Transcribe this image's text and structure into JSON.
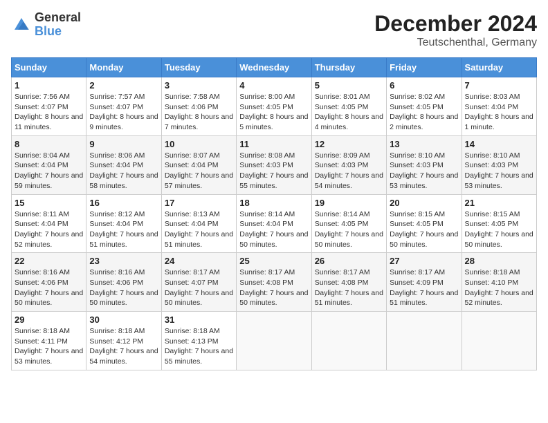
{
  "header": {
    "logo_general": "General",
    "logo_blue": "Blue",
    "title": "December 2024",
    "subtitle": "Teutschenthal, Germany"
  },
  "calendar": {
    "headers": [
      "Sunday",
      "Monday",
      "Tuesday",
      "Wednesday",
      "Thursday",
      "Friday",
      "Saturday"
    ],
    "weeks": [
      [
        {
          "day": "1",
          "sunrise": "Sunrise: 7:56 AM",
          "sunset": "Sunset: 4:07 PM",
          "daylight": "Daylight: 8 hours and 11 minutes."
        },
        {
          "day": "2",
          "sunrise": "Sunrise: 7:57 AM",
          "sunset": "Sunset: 4:07 PM",
          "daylight": "Daylight: 8 hours and 9 minutes."
        },
        {
          "day": "3",
          "sunrise": "Sunrise: 7:58 AM",
          "sunset": "Sunset: 4:06 PM",
          "daylight": "Daylight: 8 hours and 7 minutes."
        },
        {
          "day": "4",
          "sunrise": "Sunrise: 8:00 AM",
          "sunset": "Sunset: 4:05 PM",
          "daylight": "Daylight: 8 hours and 5 minutes."
        },
        {
          "day": "5",
          "sunrise": "Sunrise: 8:01 AM",
          "sunset": "Sunset: 4:05 PM",
          "daylight": "Daylight: 8 hours and 4 minutes."
        },
        {
          "day": "6",
          "sunrise": "Sunrise: 8:02 AM",
          "sunset": "Sunset: 4:05 PM",
          "daylight": "Daylight: 8 hours and 2 minutes."
        },
        {
          "day": "7",
          "sunrise": "Sunrise: 8:03 AM",
          "sunset": "Sunset: 4:04 PM",
          "daylight": "Daylight: 8 hours and 1 minute."
        }
      ],
      [
        {
          "day": "8",
          "sunrise": "Sunrise: 8:04 AM",
          "sunset": "Sunset: 4:04 PM",
          "daylight": "Daylight: 7 hours and 59 minutes."
        },
        {
          "day": "9",
          "sunrise": "Sunrise: 8:06 AM",
          "sunset": "Sunset: 4:04 PM",
          "daylight": "Daylight: 7 hours and 58 minutes."
        },
        {
          "day": "10",
          "sunrise": "Sunrise: 8:07 AM",
          "sunset": "Sunset: 4:04 PM",
          "daylight": "Daylight: 7 hours and 57 minutes."
        },
        {
          "day": "11",
          "sunrise": "Sunrise: 8:08 AM",
          "sunset": "Sunset: 4:03 PM",
          "daylight": "Daylight: 7 hours and 55 minutes."
        },
        {
          "day": "12",
          "sunrise": "Sunrise: 8:09 AM",
          "sunset": "Sunset: 4:03 PM",
          "daylight": "Daylight: 7 hours and 54 minutes."
        },
        {
          "day": "13",
          "sunrise": "Sunrise: 8:10 AM",
          "sunset": "Sunset: 4:03 PM",
          "daylight": "Daylight: 7 hours and 53 minutes."
        },
        {
          "day": "14",
          "sunrise": "Sunrise: 8:10 AM",
          "sunset": "Sunset: 4:03 PM",
          "daylight": "Daylight: 7 hours and 53 minutes."
        }
      ],
      [
        {
          "day": "15",
          "sunrise": "Sunrise: 8:11 AM",
          "sunset": "Sunset: 4:04 PM",
          "daylight": "Daylight: 7 hours and 52 minutes."
        },
        {
          "day": "16",
          "sunrise": "Sunrise: 8:12 AM",
          "sunset": "Sunset: 4:04 PM",
          "daylight": "Daylight: 7 hours and 51 minutes."
        },
        {
          "day": "17",
          "sunrise": "Sunrise: 8:13 AM",
          "sunset": "Sunset: 4:04 PM",
          "daylight": "Daylight: 7 hours and 51 minutes."
        },
        {
          "day": "18",
          "sunrise": "Sunrise: 8:14 AM",
          "sunset": "Sunset: 4:04 PM",
          "daylight": "Daylight: 7 hours and 50 minutes."
        },
        {
          "day": "19",
          "sunrise": "Sunrise: 8:14 AM",
          "sunset": "Sunset: 4:05 PM",
          "daylight": "Daylight: 7 hours and 50 minutes."
        },
        {
          "day": "20",
          "sunrise": "Sunrise: 8:15 AM",
          "sunset": "Sunset: 4:05 PM",
          "daylight": "Daylight: 7 hours and 50 minutes."
        },
        {
          "day": "21",
          "sunrise": "Sunrise: 8:15 AM",
          "sunset": "Sunset: 4:05 PM",
          "daylight": "Daylight: 7 hours and 50 minutes."
        }
      ],
      [
        {
          "day": "22",
          "sunrise": "Sunrise: 8:16 AM",
          "sunset": "Sunset: 4:06 PM",
          "daylight": "Daylight: 7 hours and 50 minutes."
        },
        {
          "day": "23",
          "sunrise": "Sunrise: 8:16 AM",
          "sunset": "Sunset: 4:06 PM",
          "daylight": "Daylight: 7 hours and 50 minutes."
        },
        {
          "day": "24",
          "sunrise": "Sunrise: 8:17 AM",
          "sunset": "Sunset: 4:07 PM",
          "daylight": "Daylight: 7 hours and 50 minutes."
        },
        {
          "day": "25",
          "sunrise": "Sunrise: 8:17 AM",
          "sunset": "Sunset: 4:08 PM",
          "daylight": "Daylight: 7 hours and 50 minutes."
        },
        {
          "day": "26",
          "sunrise": "Sunrise: 8:17 AM",
          "sunset": "Sunset: 4:08 PM",
          "daylight": "Daylight: 7 hours and 51 minutes."
        },
        {
          "day": "27",
          "sunrise": "Sunrise: 8:17 AM",
          "sunset": "Sunset: 4:09 PM",
          "daylight": "Daylight: 7 hours and 51 minutes."
        },
        {
          "day": "28",
          "sunrise": "Sunrise: 8:18 AM",
          "sunset": "Sunset: 4:10 PM",
          "daylight": "Daylight: 7 hours and 52 minutes."
        }
      ],
      [
        {
          "day": "29",
          "sunrise": "Sunrise: 8:18 AM",
          "sunset": "Sunset: 4:11 PM",
          "daylight": "Daylight: 7 hours and 53 minutes."
        },
        {
          "day": "30",
          "sunrise": "Sunrise: 8:18 AM",
          "sunset": "Sunset: 4:12 PM",
          "daylight": "Daylight: 7 hours and 54 minutes."
        },
        {
          "day": "31",
          "sunrise": "Sunrise: 8:18 AM",
          "sunset": "Sunset: 4:13 PM",
          "daylight": "Daylight: 7 hours and 55 minutes."
        },
        null,
        null,
        null,
        null
      ]
    ]
  }
}
